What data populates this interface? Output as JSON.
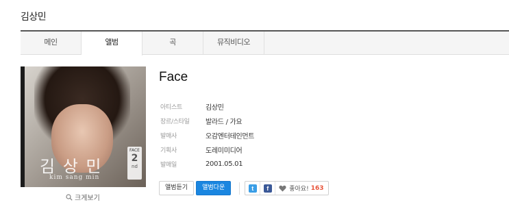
{
  "artist": {
    "name": "김상민"
  },
  "tabs": [
    {
      "label": "메인",
      "active": false
    },
    {
      "label": "앨범",
      "active": true
    },
    {
      "label": "곡",
      "active": false
    },
    {
      "label": "뮤직비디오",
      "active": false
    }
  ],
  "cover": {
    "text_name": "김 상 민",
    "text_roman": "kim sang min",
    "badge_top": "FACE",
    "badge_num": "2",
    "badge_suffix": "nd"
  },
  "zoom_label": "크게보기",
  "album": {
    "title": "Face",
    "info": [
      {
        "label": "아티스트",
        "value": "김상민"
      },
      {
        "label": "장르/스타일",
        "value": "발라드 / 가요"
      },
      {
        "label": "발매사",
        "value": "오감엔터테인먼트"
      },
      {
        "label": "기획사",
        "value": "도레미미디어"
      },
      {
        "label": "발매일",
        "value": "2001.05.01"
      }
    ]
  },
  "actions": {
    "listen_label": "앨범듣기",
    "download_label": "앨범다운",
    "like_label": "좋아요!",
    "like_count": "163"
  },
  "icons": {
    "twitter": "twitter-icon",
    "facebook": "facebook-icon",
    "heart": "heart-icon",
    "search": "search-icon"
  },
  "colors": {
    "primary_button": "#1a86e0",
    "twitter": "#3a9ee6",
    "facebook": "#3b5998",
    "like_count": "#e8543a"
  }
}
